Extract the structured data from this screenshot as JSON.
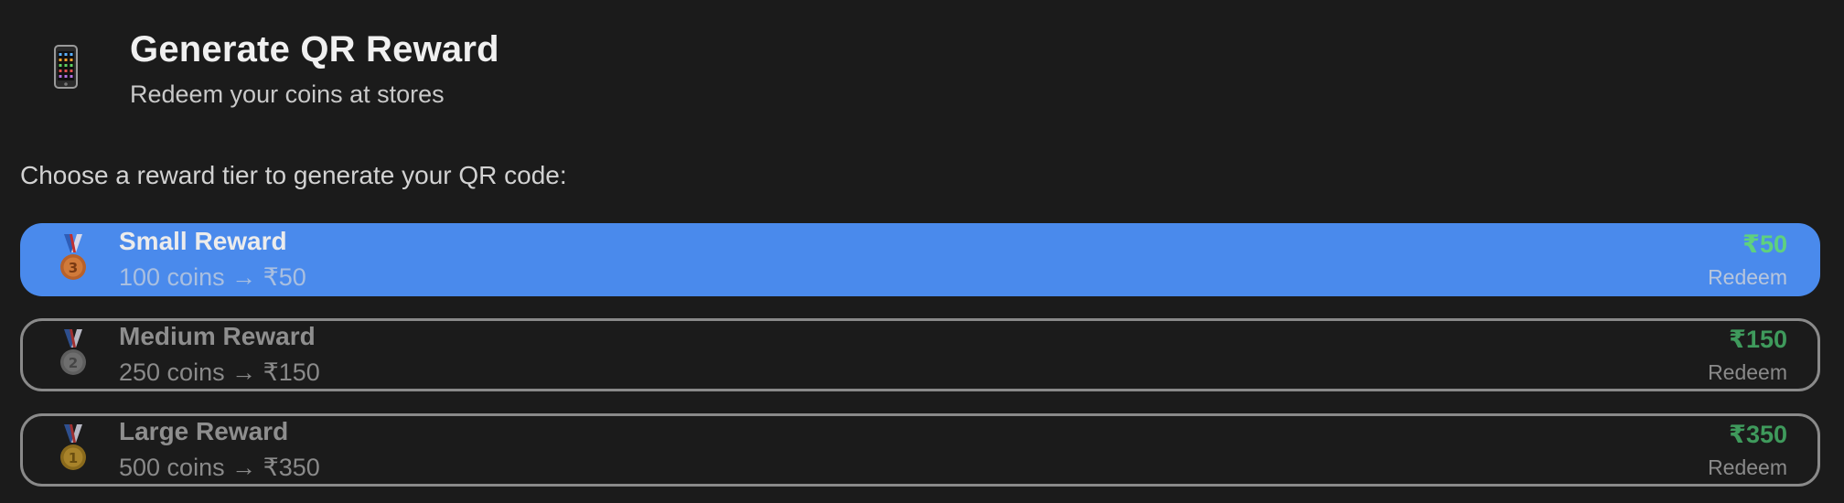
{
  "header": {
    "icon": "mobile-phone-icon",
    "title": "Generate QR Reward",
    "subtitle": "Redeem your coins at stores"
  },
  "prompt": "Choose a reward tier to generate your QR code:",
  "tiers": [
    {
      "name": "Small Reward",
      "coins_text": "100 coins → ₹50",
      "value": "₹50",
      "action": "Redeem",
      "medal_icon": "bronze-medal-icon",
      "selected": true
    },
    {
      "name": "Medium Reward",
      "coins_text": "250 coins → ₹150",
      "value": "₹150",
      "action": "Redeem",
      "medal_icon": "silver-medal-icon",
      "selected": false
    },
    {
      "name": "Large Reward",
      "coins_text": "500 coins → ₹350",
      "value": "₹350",
      "action": "Redeem",
      "medal_icon": "gold-medal-icon",
      "selected": false
    }
  ],
  "colors": {
    "background": "#1b1b1b",
    "selected_tier": "#4a8aec",
    "value_green": "#5fd17e",
    "tier_border": "#8a8a8a"
  }
}
